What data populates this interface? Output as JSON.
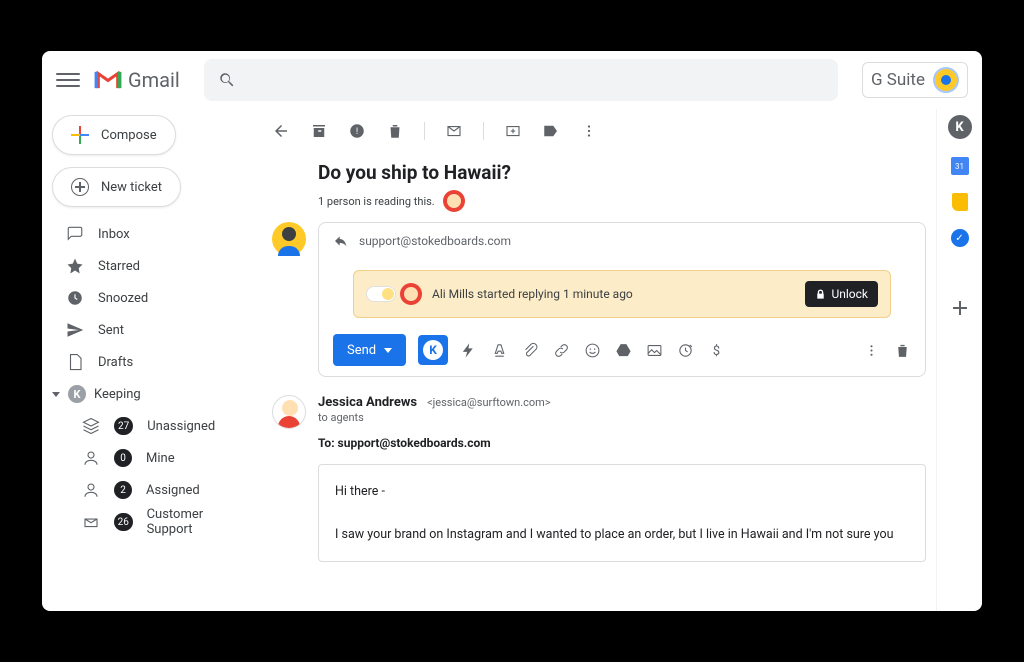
{
  "header": {
    "app_name": "Gmail",
    "gsuite_label": "G Suite"
  },
  "sidebar": {
    "compose_label": "Compose",
    "new_ticket_label": "New ticket",
    "items": [
      {
        "label": "Inbox"
      },
      {
        "label": "Starred"
      },
      {
        "label": "Snoozed"
      },
      {
        "label": "Sent"
      },
      {
        "label": "Drafts"
      }
    ],
    "keeping_label": "Keeping",
    "keeping_items": [
      {
        "count": "27",
        "label": "Unassigned"
      },
      {
        "count": "0",
        "label": "Mine"
      },
      {
        "count": "2",
        "label": "Assigned"
      },
      {
        "count": "26",
        "label": "Customer Support"
      }
    ]
  },
  "thread": {
    "subject": "Do you ship to Hawaii?",
    "reading_text": "1 person is reading this.",
    "reply_to": "support@stokedboards.com",
    "banner_text": "Ali Mills started replying 1 minute ago",
    "unlock_label": "Unlock",
    "send_label": "Send"
  },
  "message": {
    "sender_name": "Jessica Andrews",
    "sender_email": "<jessica@surftown.com>",
    "to_line": "to agents",
    "to_header": "To: support@stokedboards.com",
    "greeting": "Hi there -",
    "body_line": "I saw your brand on Instagram and I wanted to place an order, but I live in Hawaii and I'm not sure you"
  },
  "rightbar": {
    "cal_day": "31"
  }
}
